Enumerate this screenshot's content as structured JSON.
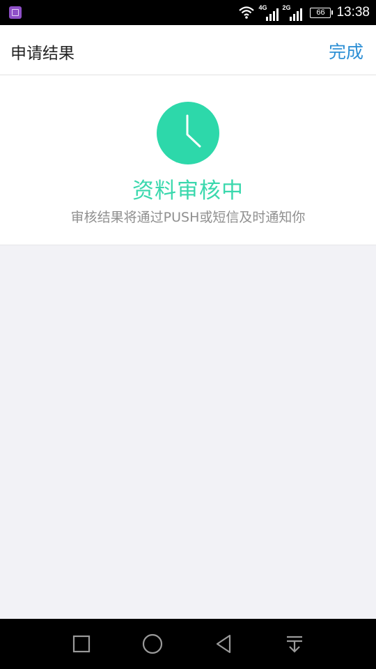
{
  "status_bar": {
    "network_1": "4G",
    "network_2": "2G",
    "battery": "66",
    "time": "13:38",
    "icons": [
      "gallery-app-icon",
      "wifi-icon",
      "signal-4g-icon",
      "signal-2g-icon",
      "battery-icon"
    ]
  },
  "header": {
    "title": "申请结果",
    "done_label": "完成",
    "accent_color": "#2d8fd5"
  },
  "result": {
    "icon": "clock-icon",
    "status": "资料审核中",
    "description": "审核结果将通过PUSH或短信及时通知你",
    "status_color": "#3ad8ad"
  },
  "nav_bar": {
    "icons": [
      "recent-apps-icon",
      "home-icon",
      "back-icon",
      "notification-pulldown-icon"
    ]
  }
}
